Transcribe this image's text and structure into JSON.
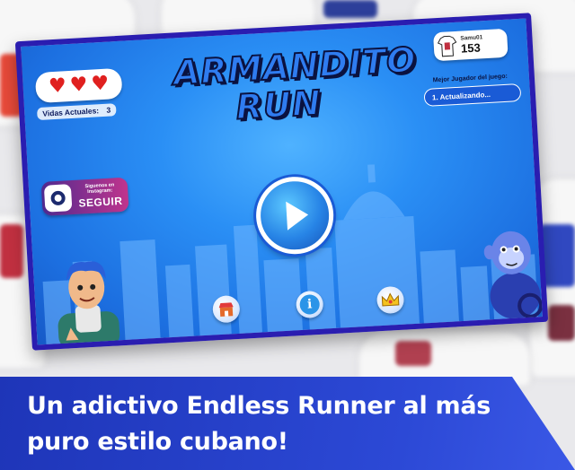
{
  "game": {
    "title_line1": "ARMANDITO",
    "title_line2": "RUN",
    "lives_label": "Vidas Actuales:",
    "lives_value": "3",
    "hearts": 3,
    "instagram_caption": "Siguenos en Instagram:",
    "instagram_button": "SEGUIR",
    "player_name": "Samu01",
    "player_score": "153",
    "best_player_label": "Mejor Jugador del juego:",
    "best_player_value": "1. Actualizando...",
    "icons": [
      "heart-icon",
      "instagram-icon",
      "tshirt-avatar-icon",
      "play-icon",
      "shop-icon",
      "info-icon",
      "crown-icon"
    ],
    "colors": {
      "frame": "#2a1db0",
      "sky": "#2a8ff5",
      "heart": "#e0201f",
      "banner": "#2c49d6"
    }
  },
  "banner": {
    "line1": "Un adictivo Endless Runner al más",
    "line2": "puro estilo cubano!"
  }
}
